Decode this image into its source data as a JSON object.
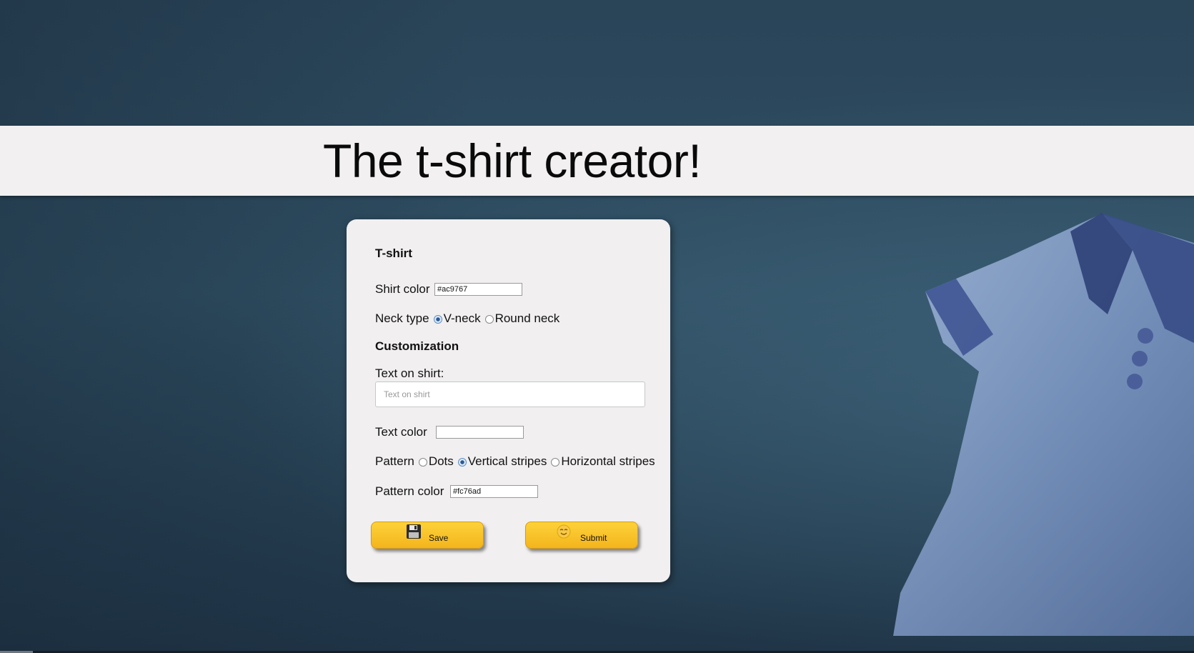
{
  "page": {
    "title": "The t-shirt creator!"
  },
  "form": {
    "tshirt_heading": "T-shirt",
    "shirt_color": {
      "label": "Shirt color",
      "value": "#ac9767"
    },
    "neck_type": {
      "label": "Neck type",
      "options": [
        "V-neck",
        "Round neck"
      ],
      "selected": "V-neck"
    },
    "customization_heading": "Customization",
    "text_on_shirt": {
      "label": "Text on shirt:",
      "placeholder": "Text on shirt",
      "value": ""
    },
    "text_color": {
      "label": "Text color",
      "value": ""
    },
    "pattern": {
      "label": "Pattern",
      "options": [
        "Dots",
        "Vertical stripes",
        "Horizontal stripes"
      ],
      "selected": "Vertical stripes"
    },
    "pattern_color": {
      "label": "Pattern color",
      "value": "#fc76ad"
    }
  },
  "buttons": {
    "save_label": "Save",
    "save_icon": "floppy-disk-icon",
    "submit_label": "Submit",
    "submit_icon": "smiley-face-icon"
  },
  "colors": {
    "button_yellow": "#fbc52a",
    "header_band": "#f2f0f1",
    "background": "#2a4458",
    "shirt_illustration": "#8ea6cd",
    "collar": "#34477a"
  },
  "decorations": {
    "shirt_illustration": "polo-shirt-illustration"
  }
}
